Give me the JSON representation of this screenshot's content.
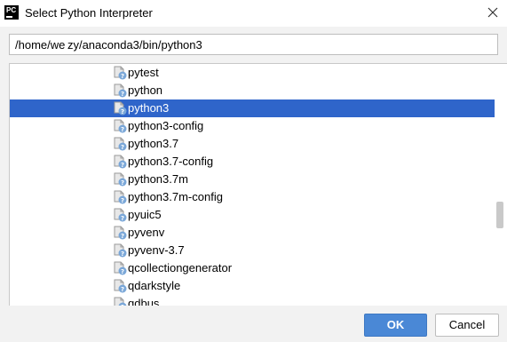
{
  "window": {
    "title": "Select Python Interpreter",
    "app_icon_text": "PC"
  },
  "path_field": {
    "value": "/home/we zy/anaconda3/bin/python3"
  },
  "tree": {
    "selected_index": 2,
    "items": [
      {
        "label": "pytest"
      },
      {
        "label": "python"
      },
      {
        "label": "python3"
      },
      {
        "label": "python3-config"
      },
      {
        "label": "python3.7"
      },
      {
        "label": "python3.7-config"
      },
      {
        "label": "python3.7m"
      },
      {
        "label": "python3.7m-config"
      },
      {
        "label": "pyuic5"
      },
      {
        "label": "pyvenv"
      },
      {
        "label": "pyvenv-3.7"
      },
      {
        "label": "qcollectiongenerator"
      },
      {
        "label": "qdarkstyle"
      },
      {
        "label": "qdbus"
      }
    ]
  },
  "buttons": {
    "ok": "OK",
    "cancel": "Cancel"
  },
  "icons": {
    "file_item": "unknown-file-icon",
    "close": "close-icon"
  },
  "colors": {
    "selection": "#2f65ca",
    "ok_button": "#4a88d6"
  }
}
